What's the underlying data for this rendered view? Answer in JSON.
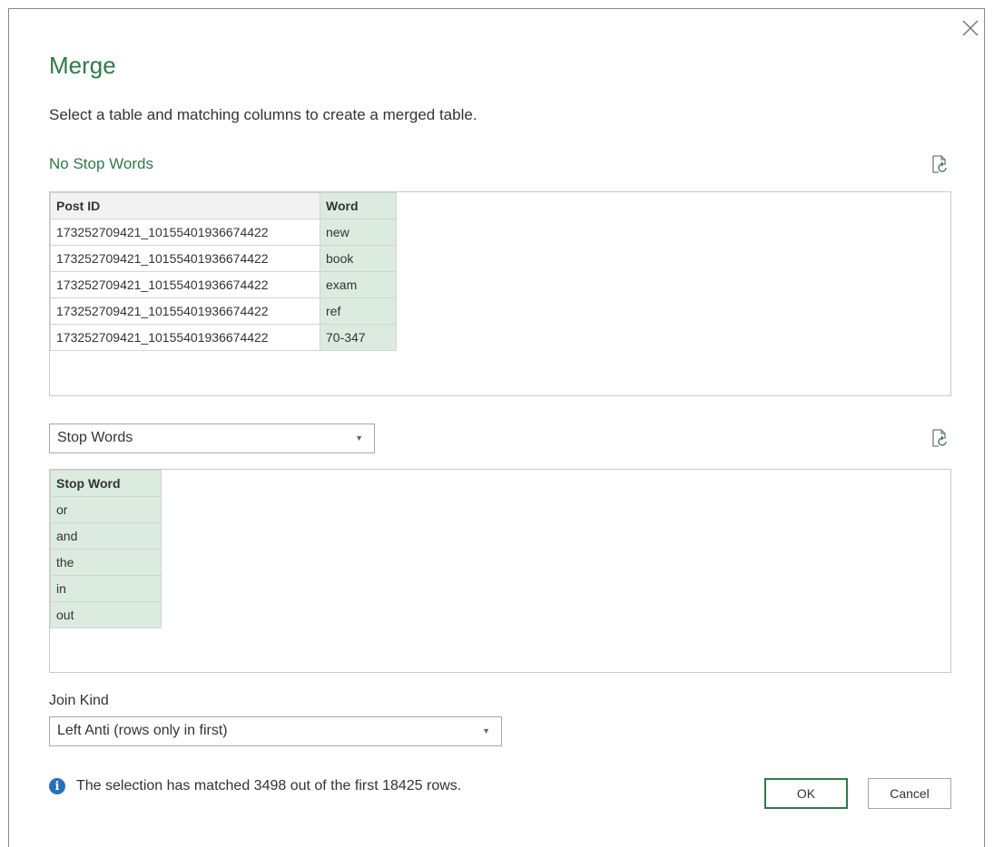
{
  "dialog": {
    "title": "Merge",
    "subtitle": "Select a table and matching columns to create a merged table.",
    "close_icon": "close-icon"
  },
  "first_table": {
    "name": "No Stop Words",
    "columns": [
      "Post ID",
      "Word"
    ],
    "selected_column": "Word",
    "rows": [
      [
        "173252709421_10155401936674422",
        "new"
      ],
      [
        "173252709421_10155401936674422",
        "book"
      ],
      [
        "173252709421_10155401936674422",
        "exam"
      ],
      [
        "173252709421_10155401936674422",
        "ref"
      ],
      [
        "173252709421_10155401936674422",
        "70-347"
      ]
    ]
  },
  "second_table": {
    "selected": "Stop Words",
    "columns": [
      "Stop Word"
    ],
    "selected_column": "Stop Word",
    "rows": [
      [
        "or"
      ],
      [
        "and"
      ],
      [
        "the"
      ],
      [
        "in"
      ],
      [
        "out"
      ]
    ]
  },
  "join": {
    "label": "Join Kind",
    "selected": "Left Anti (rows only in first)"
  },
  "status": {
    "message": "The selection has matched 3498 out of the first 18425 rows.",
    "icon": "info-icon"
  },
  "buttons": {
    "ok": "OK",
    "cancel": "Cancel"
  },
  "colors": {
    "accent": "#2e7a4a",
    "selected_column": "#dcebe0",
    "info": "#2a6ebb"
  }
}
